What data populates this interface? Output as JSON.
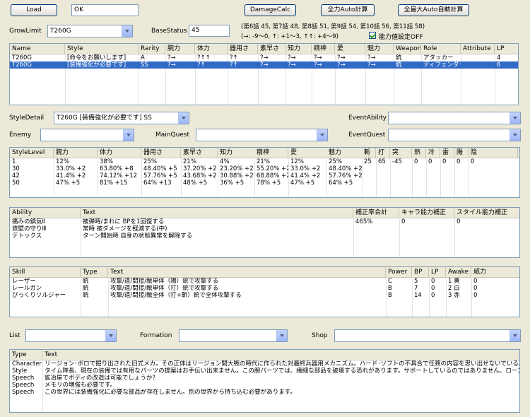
{
  "toolbar": {
    "load_label": "Load",
    "status_value": "OK",
    "damagecalc_label": "DamageCalc",
    "fullauto_label": "全力Auto計算",
    "maxauto_label": "全最大Auto自動計算"
  },
  "growlimit": {
    "label": "GrowLimit",
    "value": "T260G"
  },
  "basestatus": {
    "label": "BaseStatus",
    "value": "45"
  },
  "chapters_text": "(第6話 45, 第7話 48, 第8話 51, 第9話 54, 第10話 56, 第11話 58)",
  "arrows_text": "(→: -9〜0, ↑: +1〜3, ↑↑: +4〜9)",
  "stat_off": {
    "label": "能力値設定OFF",
    "checked": true
  },
  "style_table": {
    "headers": [
      "Name",
      "Style",
      "Rarity",
      "腕力",
      "体力",
      "器用さ",
      "素早さ",
      "知力",
      "精神",
      "愛",
      "魅力",
      "Weapon",
      "Role",
      "Attribute",
      "LP"
    ],
    "rows": [
      [
        "T260G",
        "[命令をお願いします]",
        "A",
        "?→",
        "?↑↑",
        "?↑",
        "?→",
        "?→",
        "?→",
        "?→",
        "?→",
        "銃",
        "アタッカー",
        "",
        "4"
      ],
      [
        "T260G",
        "[装備強化が必要です]",
        "SS",
        "?→",
        "?↑",
        "?↑",
        "?→",
        "?→",
        "?→",
        "?→",
        "?→",
        "銃",
        "ディフェンダー",
        "",
        "6"
      ]
    ],
    "selected_row": 1
  },
  "filters": {
    "styledetail_label": "StyleDetail",
    "styledetail_value": "T260G [装備強化が必要です] SS",
    "eventability_label": "EventAbility",
    "eventability_value": "",
    "enemy_label": "Enemy",
    "enemy_value": "",
    "mainquest_label": "MainQuest",
    "mainquest_value": "",
    "eventquest_label": "EventQuest",
    "eventquest_value": ""
  },
  "level_table": {
    "headers": [
      "StyleLevel",
      "腕力",
      "体力",
      "器用さ",
      "素早さ",
      "知力",
      "精神",
      "愛",
      "魅力",
      "斬",
      "打",
      "突",
      "熱",
      "冷",
      "雷",
      "陽",
      "陰"
    ],
    "rows": [
      [
        "1",
        "12%",
        "38%",
        "25%",
        "21%",
        "4%",
        "21%",
        "12%",
        "25%",
        "25",
        "65",
        "-45",
        "0",
        "0",
        "0",
        "0",
        "0"
      ],
      [
        "30",
        "33.0% +2",
        "63.80% +8",
        "48.40% +5",
        "37.20% +2",
        "23.20% +2",
        "55.20% +2",
        "33.0% +2",
        "48.40% +2",
        "",
        "",
        "",
        "",
        "",
        "",
        "",
        ""
      ],
      [
        "42",
        "41.4% +2",
        "74.12% +12",
        "57.76% +5",
        "43.68% +2",
        "30.88% +2",
        "68.88% +2",
        "41.4% +2",
        "57.76% +2",
        "",
        "",
        "",
        "",
        "",
        "",
        "",
        ""
      ],
      [
        "50",
        "47% +5",
        "81% +15",
        "64% +13",
        "48% +5",
        "36% +5",
        "78% +5",
        "47% +5",
        "64% +5",
        "",
        "",
        "",
        "",
        "",
        "",
        "",
        ""
      ]
    ]
  },
  "ability_table": {
    "headers": [
      "Ability",
      "Text",
      "補正率合計",
      "キャラ能力補正",
      "スタイル能力補正"
    ],
    "rows": [
      [
        "痛みの鎮気Ⅱ",
        "被弾時/まれに BPを1回復する",
        "465%",
        "0",
        "0"
      ],
      [
        "鉄壁の守りⅢ",
        "常時 被ダメージを軽減する(中)",
        "",
        "",
        ""
      ],
      [
        "デトックス",
        "ターン開始時 自身の状態異常を解除する",
        "",
        "",
        ""
      ]
    ]
  },
  "skill_table": {
    "headers": [
      "Skill",
      "Type",
      "Text",
      "Power",
      "BP",
      "LP",
      "Awake",
      "威力"
    ],
    "rows": [
      [
        "レーザー",
        "銃",
        "攻撃/遠/間接/敵単体（陽）銃で攻撃する",
        "C",
        "5",
        "0",
        "1 黄",
        "0"
      ],
      [
        "レールガン",
        "銃",
        "攻撃/遠/間接/敵単体（打）銃で攻撃する",
        "B",
        "7",
        "0",
        "2 白",
        "0"
      ],
      [
        "びっくりソルジャー",
        "銃",
        "攻撃/遠/間接/敵全体（打+斬）銃で全体攻撃する",
        "B",
        "14",
        "0",
        "3 赤",
        "0"
      ]
    ]
  },
  "bottom_filters": {
    "list_label": "List",
    "list_value": "",
    "formation_label": "Formation",
    "formation_value": "",
    "shop_label": "Shop",
    "shop_value": ""
  },
  "text_table": {
    "headers": [
      "Type",
      "Text"
    ],
    "rows": [
      [
        "Character",
        "リージョン･ボロで掘り出された旧式メカ。その正体はリージョン間大戦の時代に作られた対最終兵器用メカニズム。ハード･ソフトの不具合で任務の内容を思い出せないでいる。"
      ],
      [
        "Style",
        "タイム隊長、現在の装備では有用なパーツの提案はお手伝い出来ません。この腕パーツでは、繊細な部品を破壊する恐れがあります。サポートしているのではありません、ローズ様。"
      ],
      [
        "Speech",
        "鉱冶屋でボディの改造は可能でしょうか？"
      ],
      [
        "Speech",
        "メモリの増強も必要です。"
      ],
      [
        "Speech",
        "この世界には装備強化に必要な部品が存在しません。別の世界から持ち込む必要があります。"
      ]
    ]
  },
  "colors": {
    "selection": "#316ac5",
    "window_bg": "#ece9d8",
    "border": "#7f9db9"
  }
}
